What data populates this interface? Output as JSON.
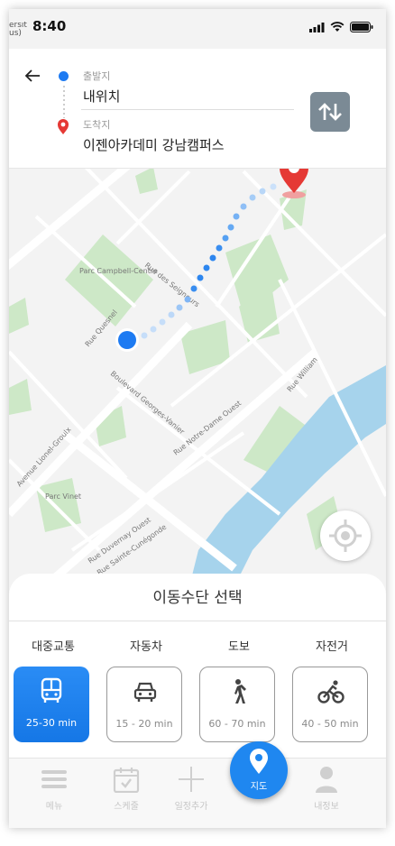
{
  "status": {
    "carrier_hint": "ersity\nus)",
    "time": "8:40"
  },
  "route": {
    "start_label": "출발지",
    "start_value": "내위치",
    "end_label": "도착지",
    "end_value": "이젠아카데미 강남캠퍼스"
  },
  "map": {
    "labels": [
      "Parc Campbell-Centre",
      "Rue des Seigneurs",
      "Rue Quesnel",
      "Boulevard Georges-Vanier",
      "Rue Notre-Dame Ouest",
      "Rue William",
      "Avenue Lionel-Groulx",
      "Parc Vinet",
      "Rue Duvernay Ouest",
      "Rue Sainte-Cunégonde"
    ]
  },
  "sheet": {
    "title": "이동수단 선택",
    "modes": [
      {
        "label": "대중교통",
        "time": "25-30 min",
        "icon": "bus-icon",
        "active": true
      },
      {
        "label": "자동차",
        "time": "15 - 20 min",
        "icon": "car-icon",
        "active": false
      },
      {
        "label": "도보",
        "time": "60 - 70 min",
        "icon": "walk-icon",
        "active": false
      },
      {
        "label": "자전거",
        "time": "40 - 50 min",
        "icon": "bicycle-icon",
        "active": false
      }
    ]
  },
  "tabs": {
    "menu": "메뉴",
    "schedule": "스케줄",
    "add_schedule": "일정추가",
    "map": "지도",
    "profile": "내정보"
  },
  "colors": {
    "accent": "#1e7bf2",
    "pin": "#e53935",
    "park": "#c9e6c3",
    "water": "#9fd0ea"
  }
}
